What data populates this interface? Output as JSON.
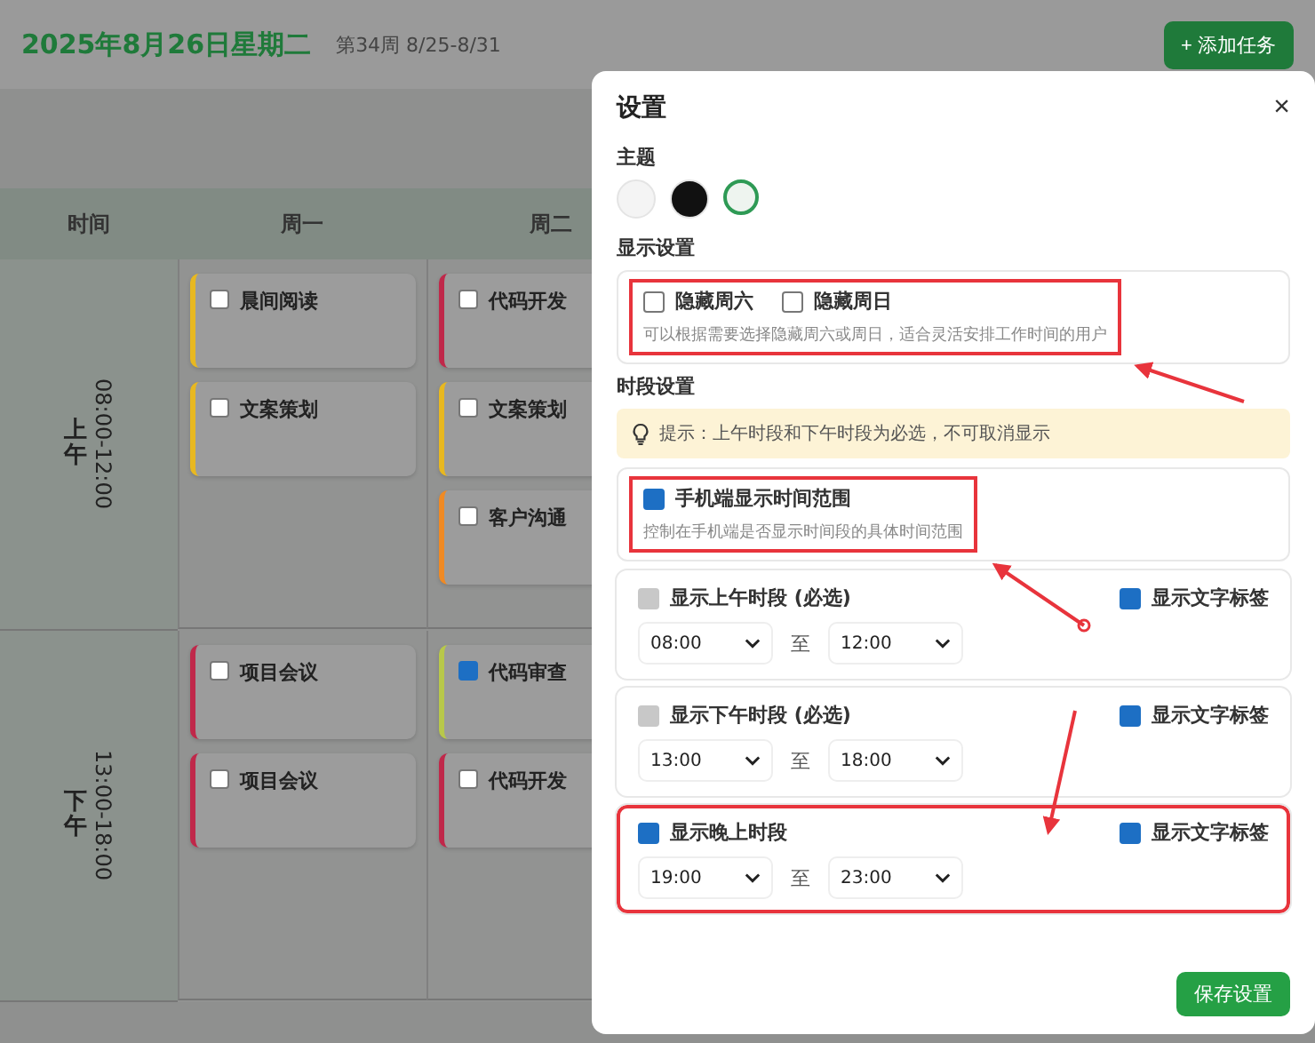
{
  "header": {
    "date": "2025年8月26日星期二",
    "week": "第34周 8/25-8/31",
    "add_button": "+ 添加任务"
  },
  "planner": {
    "columns": [
      "时间",
      "周一",
      "周二"
    ],
    "rows": [
      {
        "period": "上午",
        "range": "08:00-12:00",
        "days": [
          [
            {
              "title": "晨间阅读",
              "color": "#e8b820",
              "checked": false
            },
            {
              "title": "文案策划",
              "color": "#e8b820",
              "checked": false
            }
          ],
          [
            {
              "title": "代码开发",
              "color": "#c0284a",
              "checked": false
            },
            {
              "title": "文案策划",
              "color": "#e8b820",
              "checked": false
            },
            {
              "title": "客户沟通",
              "color": "#f08a24",
              "checked": false
            }
          ]
        ]
      },
      {
        "period": "下午",
        "range": "13:00-18:00",
        "days": [
          [
            {
              "title": "项目会议",
              "color": "#c0284a",
              "checked": false
            },
            {
              "title": "项目会议",
              "color": "#c0284a",
              "checked": false
            }
          ],
          [
            {
              "title": "代码审查",
              "color": "#b8c84a",
              "checked": true
            },
            {
              "title": "代码开发",
              "color": "#c0284a",
              "checked": false
            }
          ]
        ]
      }
    ]
  },
  "dialog": {
    "title": "设置",
    "close": "×",
    "theme": {
      "label": "主题",
      "swatches": [
        {
          "color": "#f4f4f4",
          "selected": false
        },
        {
          "color": "#111111",
          "selected": false
        },
        {
          "color": "#eef4ef",
          "selected": true
        }
      ]
    },
    "display": {
      "label": "显示设置",
      "highlight": true,
      "options": [
        {
          "label": "隐藏周六",
          "checked": false
        },
        {
          "label": "隐藏周日",
          "checked": false
        }
      ],
      "hint": "可以根据需要选择隐藏周六或周日，适合灵活安排工作时间的用户"
    },
    "periods_label": "时段设置",
    "tip": "提示：上午时段和下午时段为必选，不可取消显示",
    "mobile": {
      "label": "手机端显示时间范围",
      "checked": true,
      "highlight": true,
      "hint": "控制在手机端是否显示时间段的具体时间范围"
    },
    "periods": [
      {
        "label": "显示上午时段 (必选)",
        "checked": true,
        "disabled": true,
        "highlight": false,
        "show_label": {
          "label": "显示文字标签",
          "checked": true
        },
        "start": "08:00",
        "separator": "至",
        "end": "12:00"
      },
      {
        "label": "显示下午时段 (必选)",
        "checked": true,
        "disabled": true,
        "highlight": false,
        "show_label": {
          "label": "显示文字标签",
          "checked": true
        },
        "start": "13:00",
        "separator": "至",
        "end": "18:00"
      },
      {
        "label": "显示晚上时段",
        "checked": true,
        "disabled": false,
        "highlight": true,
        "show_label": {
          "label": "显示文字标签",
          "checked": true
        },
        "start": "19:00",
        "separator": "至",
        "end": "23:00"
      }
    ],
    "save": "保存设置"
  }
}
